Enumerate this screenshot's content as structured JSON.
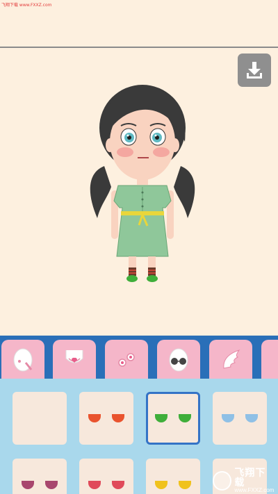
{
  "watermark_top": "飞翔下载 www.FXXZ.com",
  "download_button": {
    "icon": "download-icon"
  },
  "character": {
    "description_icon": "chibi-girl-avatar"
  },
  "categories": [
    {
      "id": "face",
      "icon": "face-icon"
    },
    {
      "id": "necklace",
      "icon": "necklace-icon"
    },
    {
      "id": "earrings",
      "icon": "earrings-icon"
    },
    {
      "id": "glasses",
      "icon": "glasses-icon"
    },
    {
      "id": "wings",
      "icon": "wings-icon"
    },
    {
      "id": "more",
      "icon": "more-icon"
    }
  ],
  "items": [
    {
      "id": "none",
      "colors": []
    },
    {
      "id": "orange-shoes",
      "colors": [
        "#e9532e",
        "#e9532e"
      ]
    },
    {
      "id": "green-shoes",
      "colors": [
        "#3fae3a",
        "#3fae3a"
      ],
      "selected": true
    },
    {
      "id": "blue-shoes",
      "colors": [
        "#8fc0e6",
        "#8fc0e6"
      ]
    },
    {
      "id": "purple-shoes",
      "colors": [
        "#a8466e",
        "#a8466e"
      ]
    },
    {
      "id": "red-shoes",
      "colors": [
        "#e04a5a",
        "#e04a5a"
      ]
    },
    {
      "id": "yellow-shoes",
      "colors": [
        "#f0c21c",
        "#f0c21c"
      ]
    },
    {
      "id": "extra",
      "colors": []
    }
  ],
  "watermark_bottom": {
    "title": "飞翔下载",
    "url": "www.FXXZ.com"
  },
  "colors": {
    "background": "#fdf0df",
    "tab_bar": "#2a6fb8",
    "tab": "#f5b6c9",
    "panel": "#a9d8ec",
    "item": "#f7e8dc",
    "selected_border": "#3473c6"
  }
}
